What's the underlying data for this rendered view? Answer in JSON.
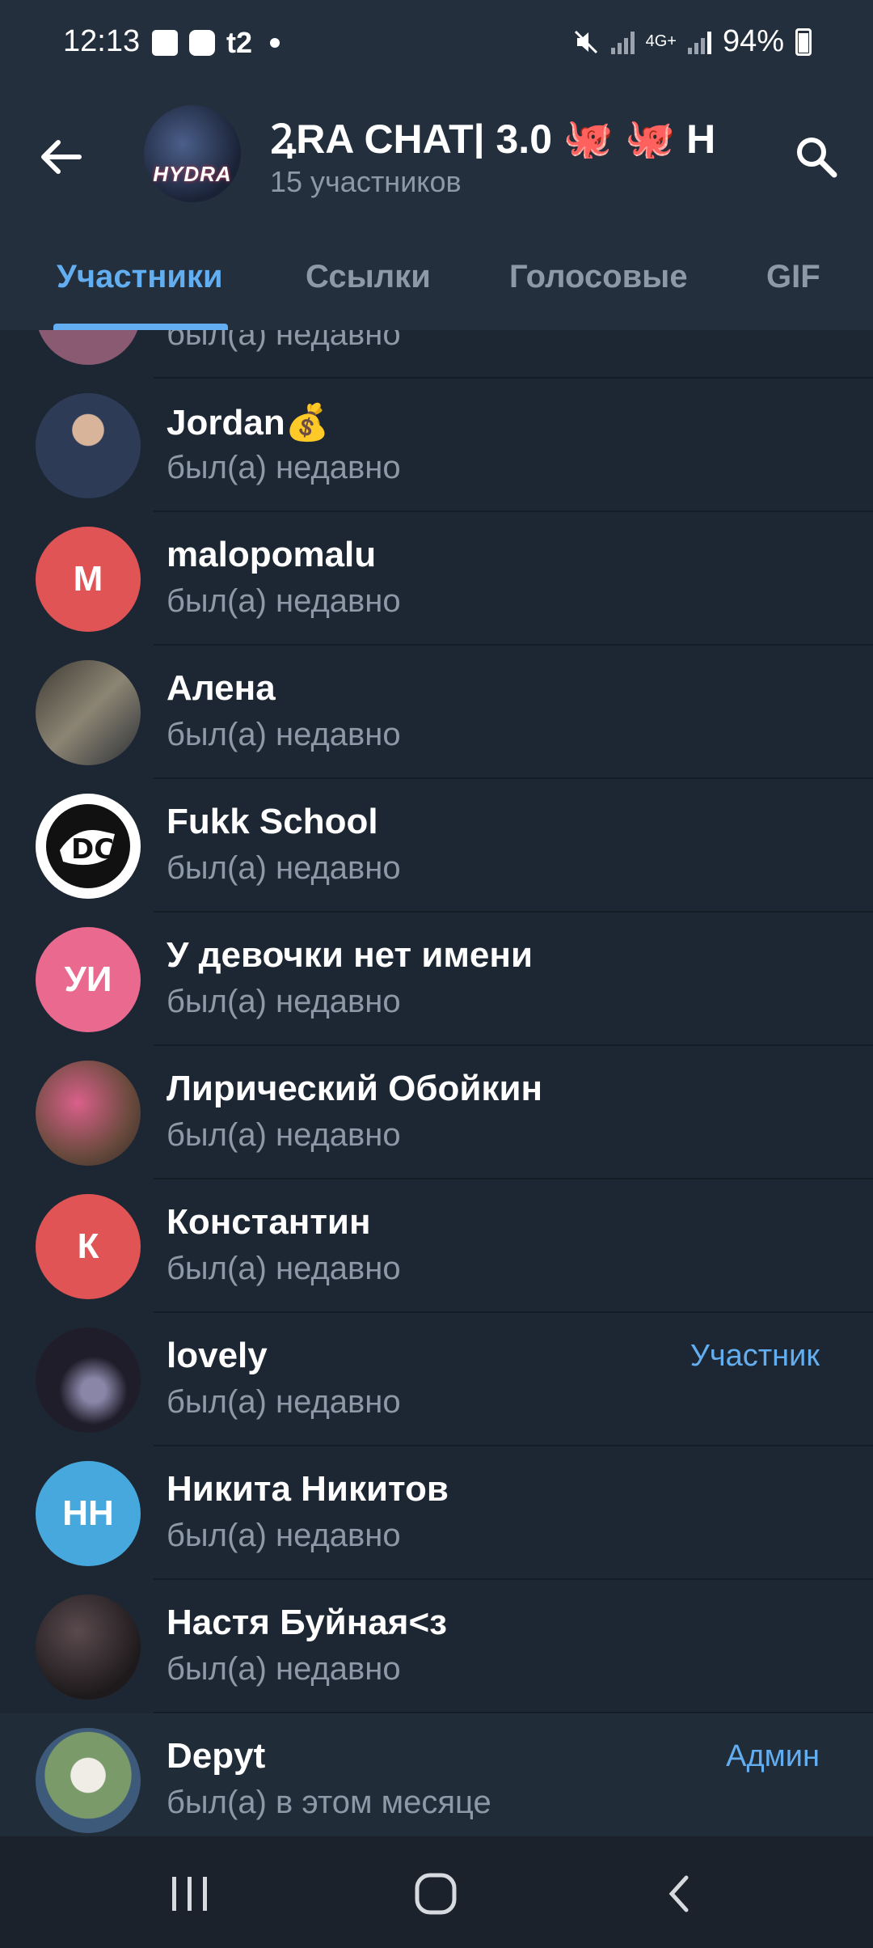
{
  "status_bar": {
    "time": "12:13",
    "carrier": "t2",
    "network": "4G+",
    "battery": "94%"
  },
  "header": {
    "title": "ꝜRA CHAT| 3.0 🐙  🐙 H",
    "subtitle": "15 участников",
    "avatar_text": "HYDRA"
  },
  "tabs": [
    {
      "label": "Участники",
      "active": true
    },
    {
      "label": "Ссылки",
      "active": false
    },
    {
      "label": "Голосовые",
      "active": false
    },
    {
      "label": "GIF",
      "active": false
    }
  ],
  "members": [
    {
      "name": "",
      "status": "был(а) недавно",
      "initials": "",
      "avatar_color": "#8a5a72",
      "role": ""
    },
    {
      "name": "Jordan💰",
      "status": "был(а) недавно",
      "initials": "",
      "avatar_color": "#3b4a63",
      "role": ""
    },
    {
      "name": "malopomalu",
      "status": "был(а) недавно",
      "initials": "M",
      "avatar_color": "#e05456",
      "role": ""
    },
    {
      "name": "Алена",
      "status": "был(а) недавно",
      "initials": "",
      "avatar_color": "#6b6458",
      "role": ""
    },
    {
      "name": "Fukk School",
      "status": "был(а) недавно",
      "initials": "",
      "avatar_color": "#ffffff",
      "role": ""
    },
    {
      "name": "У девочки нет имени",
      "status": "был(а) недавно",
      "initials": "УИ",
      "avatar_color": "#e9698f",
      "role": ""
    },
    {
      "name": "Лирический Обойкин",
      "status": "был(а) недавно",
      "initials": "",
      "avatar_color": "#a35c6c",
      "role": ""
    },
    {
      "name": "Константин",
      "status": "был(а) недавно",
      "initials": "К",
      "avatar_color": "#e05456",
      "role": ""
    },
    {
      "name": "lovely",
      "status": "был(а) недавно",
      "initials": "",
      "avatar_color": "#1f1d2a",
      "role": "Участник"
    },
    {
      "name": "Никита Никитов",
      "status": "был(а) недавно",
      "initials": "НН",
      "avatar_color": "#46a8dd",
      "role": ""
    },
    {
      "name": "Настя Буйная<з",
      "status": "был(а) недавно",
      "initials": "",
      "avatar_color": "#2e2328",
      "role": ""
    },
    {
      "name": "Depyt",
      "status": "был(а) в этом месяце",
      "initials": "",
      "avatar_color": "#7a8f6b",
      "role": "Админ"
    }
  ],
  "colors": {
    "background": "#1d2733",
    "header": "#232f3d",
    "accent": "#62aef0",
    "secondary_text": "#8d99a6"
  }
}
